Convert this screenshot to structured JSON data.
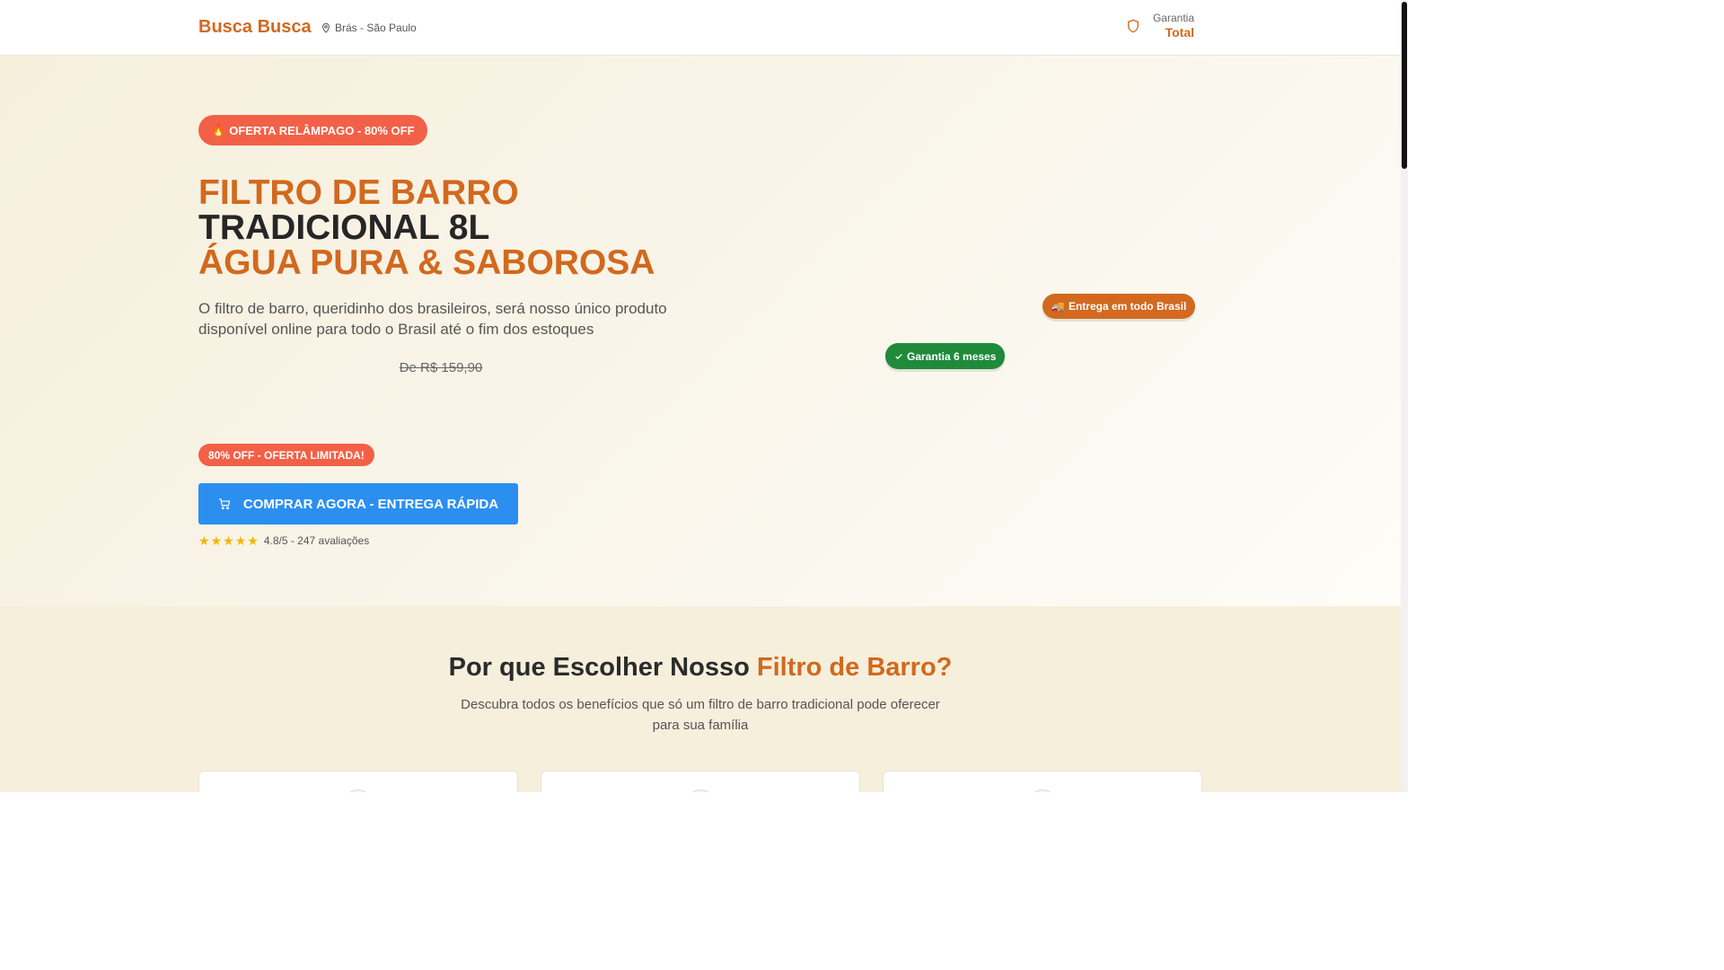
{
  "header": {
    "brand": "Busca Busca",
    "location": "Brás - São Paulo",
    "guarantee_line1": "Garantia",
    "guarantee_line2": "Total"
  },
  "hero": {
    "flash_badge_icon": "fire-emoji",
    "flash_badge_emoji": "🔥",
    "flash_badge": "OFERTA RELÂMPAGO - 80% OFF",
    "title_line1": "FILTRO DE BARRO",
    "title_line2": "TRADICIONAL 8L",
    "title_line3": "ÁGUA PURA & SABOROSA",
    "description": "O filtro de barro, queridinho dos brasileiros, será nosso único produto disponível online para todo o Brasil até o fim dos estoques",
    "old_price": "De R$ 159,90",
    "discount_badge": "80% OFF - OFERTA LIMITADA!",
    "buy_button": "COMPRAR AGORA - ENTREGA RÁPIDA",
    "rating": {
      "stars": 5,
      "text": "4.8/5 - 247 avaliações"
    },
    "delivery_tag_emoji": "🚚",
    "delivery_tag": "Entrega em todo Brasil",
    "warranty_tag": "Garantia 6 meses"
  },
  "benefits": {
    "title_part1": "Por que Escolher Nosso ",
    "title_highlight": "Filtro de Barro?",
    "subtitle": "Descubra todos os benefícios que só um filtro de barro tradicional pode oferecer para sua família"
  },
  "colors": {
    "brand": "#d2691e",
    "badge_red": "#f26147",
    "button_blue": "#2b8ff0",
    "green": "#1f8a3b",
    "star": "#f5b400"
  }
}
